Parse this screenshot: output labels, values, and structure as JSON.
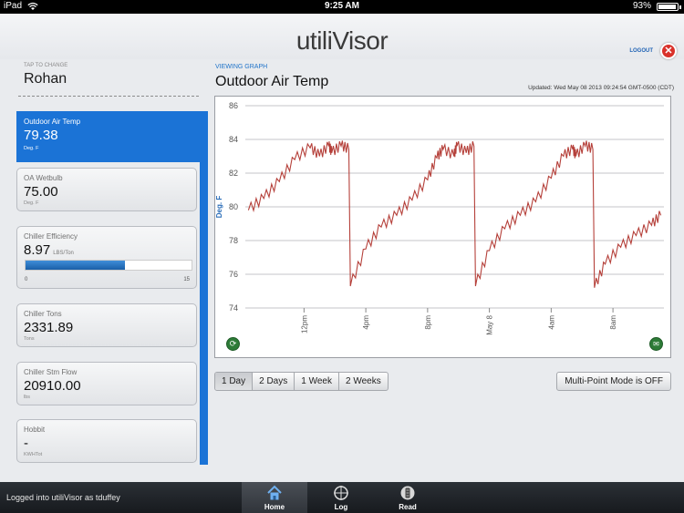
{
  "status_bar": {
    "carrier": "iPad",
    "time": "9:25 AM",
    "battery": "93%"
  },
  "header": {
    "logo_text": "utiliVisor",
    "logout_label": "LOGOUT",
    "logout_icon": "close-icon"
  },
  "left_panel": {
    "tap_label": "TAP TO CHANGE",
    "user_name": "Rohan",
    "cards": [
      {
        "title": "Outdoor Air Temp",
        "value": "79.38",
        "unit": "Deg. F",
        "selected": true
      },
      {
        "title": "OA Wetbulb",
        "value": "75.00",
        "unit": "Deg. F"
      },
      {
        "title": "Chiller Efficiency",
        "value": "8.97",
        "unit": "LBS/Ton",
        "progress": {
          "min": "0",
          "max": "15",
          "fraction": 0.598
        }
      },
      {
        "title": "Chiller Tons",
        "value": "2331.89",
        "unit": "Tons"
      },
      {
        "title": "Chiller Stm Flow",
        "value": "20910.00",
        "unit": "lbs"
      },
      {
        "title": "Hobbit",
        "value": "-",
        "unit": "KWHTot"
      }
    ]
  },
  "viewing": {
    "label": "VIEWING GRAPH",
    "title": "Outdoor Air Temp",
    "updated": "Updated: Wed May 08 2013 09:24:54 GMT-0500 (CDT)"
  },
  "chart_data": {
    "type": "line",
    "ylabel": "Deg. F",
    "xlabel": "",
    "ylim": [
      74,
      86
    ],
    "y_ticks": [
      74,
      76,
      78,
      80,
      82,
      84,
      86
    ],
    "x_ticks": [
      "12pm",
      "4pm",
      "8pm",
      "May 8",
      "4am",
      "8am"
    ],
    "x_tick_hours": [
      0,
      4,
      8,
      12,
      16,
      20
    ],
    "xlim_hours": [
      -3.8,
      23.3
    ],
    "grid": true,
    "series_color": "#b5403a",
    "x_hours": [
      -3.6,
      -2.6,
      -1.6,
      -0.6,
      0.4,
      1.0,
      1.6,
      1.8,
      2.4,
      2.9,
      3.0,
      4.0,
      5.0,
      6.0,
      7.0,
      8.0,
      8.6,
      9.0,
      9.7,
      9.9,
      10.5,
      11.0,
      11.1,
      12.0,
      13.0,
      14.0,
      15.0,
      16.0,
      16.8,
      17.4,
      17.6,
      18.2,
      18.7,
      18.8,
      19.5,
      20.5,
      21.5,
      22.5,
      23.1
    ],
    "y_values": [
      79.8,
      80.5,
      81.5,
      82.8,
      83.5,
      83.0,
      83.6,
      83.2,
      83.6,
      83.4,
      75.3,
      77.5,
      78.8,
      79.5,
      80.4,
      81.6,
      82.9,
      83.4,
      83.0,
      83.6,
      83.2,
      83.6,
      75.3,
      77.4,
      78.7,
      79.5,
      80.3,
      81.7,
      83.0,
      83.4,
      83.0,
      83.6,
      83.4,
      75.2,
      76.6,
      77.6,
      78.3,
      78.9,
      79.5
    ]
  },
  "range_buttons": [
    "1 Day",
    "2 Days",
    "1 Week",
    "2 Weeks"
  ],
  "active_range": "1 Day",
  "multi_point_label": "Multi-Point Mode is OFF",
  "bottom_bar": {
    "login_status": "Logged into utiliVisor as tduffey",
    "tabs": [
      {
        "label": "Home",
        "icon": "home-icon",
        "active": true
      },
      {
        "label": "Log",
        "icon": "log-icon"
      },
      {
        "label": "Read",
        "icon": "read-icon"
      }
    ]
  },
  "colors": {
    "accent": "#1b73d6",
    "logout": "#d9322b",
    "action_green": "#2d7b37"
  }
}
